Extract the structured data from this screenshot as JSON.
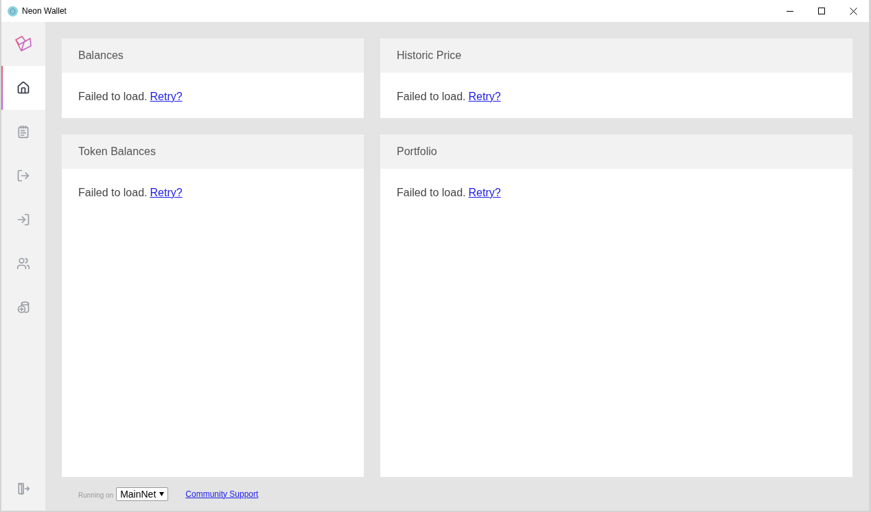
{
  "window": {
    "title": "Neon Wallet"
  },
  "sidebar": {
    "items": [
      {
        "selected": true
      },
      {
        "selected": false
      },
      {
        "selected": false
      },
      {
        "selected": false
      },
      {
        "selected": false
      },
      {
        "selected": false
      }
    ]
  },
  "panels": [
    {
      "title": "Balances",
      "message": "Failed to load.",
      "link": "Retry?"
    },
    {
      "title": "Historic Price",
      "message": "Failed to load.",
      "link": "Retry?"
    },
    {
      "title": "Token Balances",
      "message": "Failed to load.",
      "link": "Retry?"
    },
    {
      "title": "Portfolio",
      "message": "Failed to load.",
      "link": "Retry?"
    }
  ],
  "footer": {
    "network_label": "Running on",
    "network_select": {
      "value": "MainNet"
    },
    "support_link": "Community Support"
  }
}
